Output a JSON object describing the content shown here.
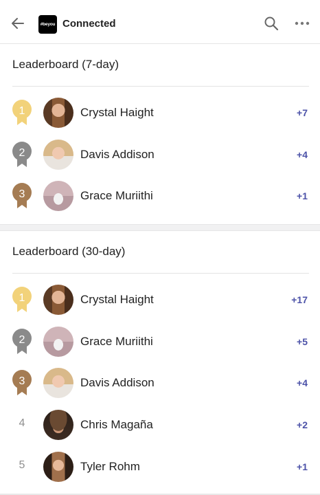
{
  "header": {
    "logo_text": "#beyou",
    "title": "Connected",
    "icons": [
      "back-arrow-icon",
      "search-icon",
      "more-icon"
    ]
  },
  "leaderboards": [
    {
      "title": "Leaderboard (7-day)",
      "rows": [
        {
          "rank": "1",
          "name": "Crystal Haight",
          "score": "+7",
          "medal": "gold"
        },
        {
          "rank": "2",
          "name": "Davis Addison",
          "score": "+4",
          "medal": "silver"
        },
        {
          "rank": "3",
          "name": "Grace Muriithi",
          "score": "+1",
          "medal": "bronze"
        }
      ]
    },
    {
      "title": "Leaderboard (30-day)",
      "rows": [
        {
          "rank": "1",
          "name": "Crystal Haight",
          "score": "+17",
          "medal": "gold"
        },
        {
          "rank": "2",
          "name": "Grace Muriithi",
          "score": "+5",
          "medal": "silver"
        },
        {
          "rank": "3",
          "name": "Davis Addison",
          "score": "+4",
          "medal": "bronze"
        },
        {
          "rank": "4",
          "name": "Chris Magaña",
          "score": "+2",
          "medal": ""
        },
        {
          "rank": "5",
          "name": "Tyler Rohm",
          "score": "+1",
          "medal": ""
        }
      ]
    }
  ],
  "colors": {
    "gold": "#f2d27a",
    "silver": "#8a8a8a",
    "bronze": "#a57c53",
    "score": "#4c52a8"
  }
}
